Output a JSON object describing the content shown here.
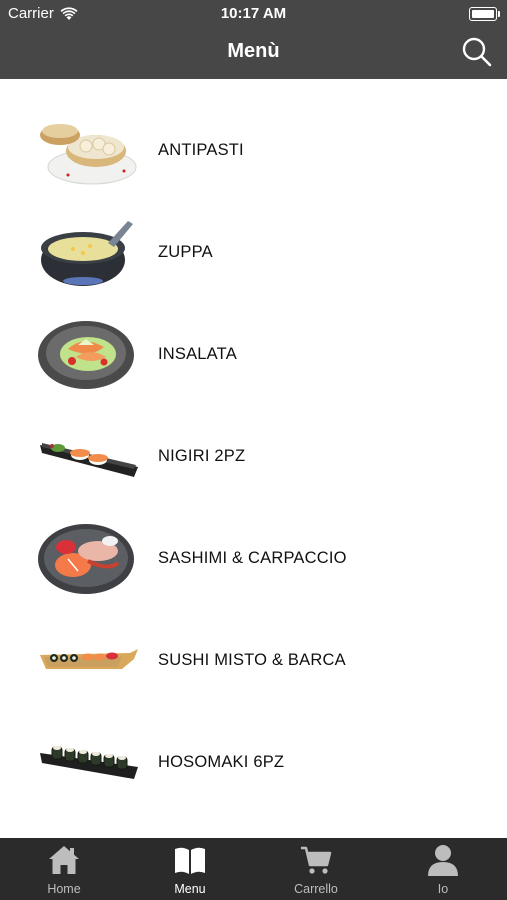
{
  "status_bar": {
    "carrier": "Carrier",
    "time": "10:17 AM"
  },
  "header": {
    "title": "Menù",
    "search_icon": "search-icon"
  },
  "categories": [
    {
      "label": "ANTIPASTI",
      "image": "dumplings-image"
    },
    {
      "label": "ZUPPA",
      "image": "soup-image"
    },
    {
      "label": "INSALATA",
      "image": "salad-image"
    },
    {
      "label": "NIGIRI 2PZ",
      "image": "nigiri-image"
    },
    {
      "label": "SASHIMI & CARPACCIO",
      "image": "sashimi-image"
    },
    {
      "label": "SUSHI MISTO & BARCA",
      "image": "sushi-boat-image"
    },
    {
      "label": "HOSOMAKI 6PZ",
      "image": "hosomaki-image"
    }
  ],
  "tabbar": {
    "tabs": [
      {
        "label": "Home",
        "icon": "home-icon"
      },
      {
        "label": "Menu",
        "icon": "book-icon",
        "active": true
      },
      {
        "label": "Carrello",
        "icon": "cart-icon"
      },
      {
        "label": "Io",
        "icon": "person-icon"
      }
    ]
  },
  "colors": {
    "header_bg": "#474747",
    "tabbar_bg": "#2b2b2b",
    "tab_active": "#ffffff",
    "tab_inactive": "#bdbdbd"
  }
}
